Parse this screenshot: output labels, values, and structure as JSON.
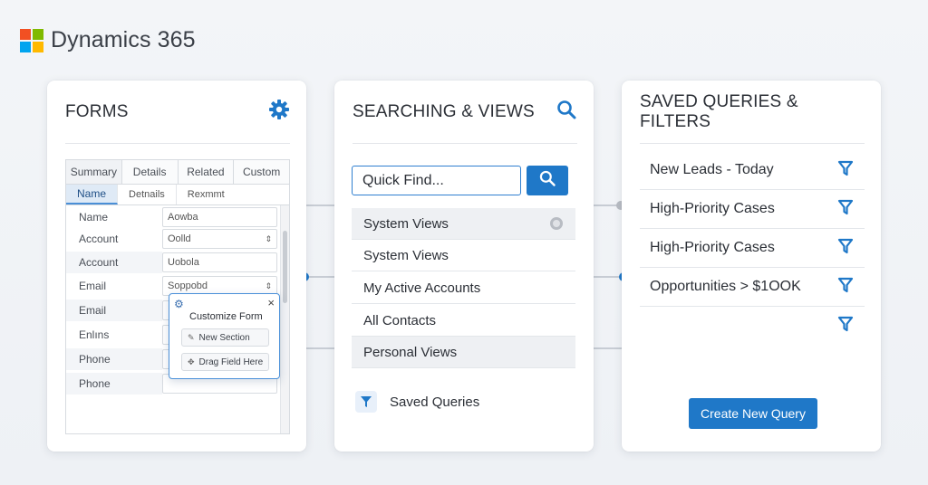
{
  "brand": {
    "name": "Dynamics 365",
    "logo_colors": [
      "#f25022",
      "#7fba00",
      "#00a4ef",
      "#ffb900"
    ]
  },
  "accent": "#1f78c8",
  "forms": {
    "title": "FORMS",
    "settings_icon": "gear-icon",
    "tabs": [
      "Summary",
      "Details",
      "Related",
      "Custom"
    ],
    "subtabs": [
      "Name",
      "Detnails",
      "Rexmmt"
    ],
    "rows": [
      {
        "label": "Name",
        "value": "Aowba",
        "has_stepper": false
      },
      {
        "label": "Account",
        "value": "Oolld",
        "has_stepper": true
      },
      {
        "label": "Account",
        "value": "Uobola",
        "has_stepper": false
      },
      {
        "label": "Email",
        "value": "Soppobd",
        "has_stepper": true
      },
      {
        "label": "Email",
        "value": "",
        "has_stepper": false
      },
      {
        "label": "Enlıns",
        "value": "",
        "has_stepper": false
      },
      {
        "label": "Phone",
        "value": "",
        "has_stepper": false
      },
      {
        "label": "Phone",
        "value": "",
        "has_stepper": false
      }
    ],
    "popup": {
      "title": "Customize Form",
      "close": "×",
      "new_section": "New Section",
      "drag_field": "Drag Field Here"
    }
  },
  "search": {
    "title": "SEARCHING & VIEWS",
    "quick_find_placeholder": "Quick Find...",
    "views": [
      "System Views",
      "System Views",
      "My Active Accounts",
      "All Contacts",
      "Personal Views"
    ],
    "saved_queries_label": "Saved Queries"
  },
  "queries": {
    "title": "SAVED QUERIES & FILTERS",
    "items": [
      "New Leads - Today",
      "High-Priority Cases",
      "High-Priority Cases",
      "Opportunities > $1OOK",
      ""
    ],
    "create_button": "Create New Query"
  }
}
